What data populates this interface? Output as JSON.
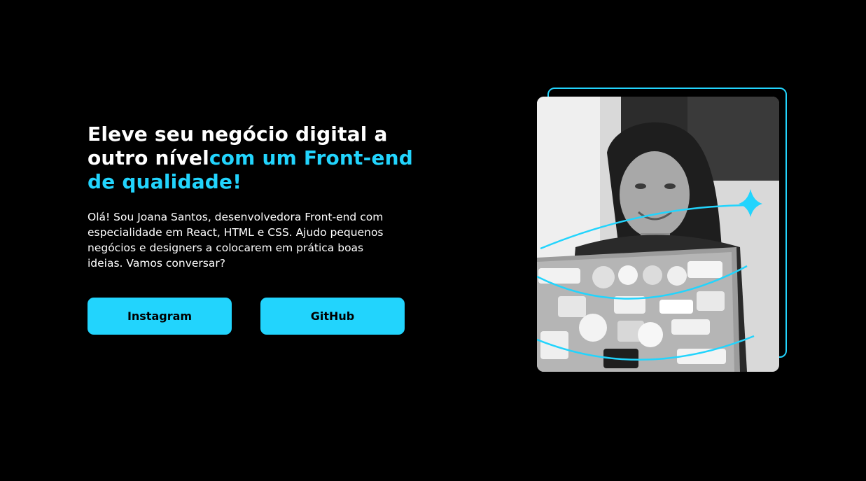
{
  "hero": {
    "headline_white": "Eleve seu negócio digital a outro nível",
    "headline_accent": "com um Front-end de qualidade!",
    "intro": "Olá! Sou Joana Santos, desenvolvedora Front-end com especialidade em React, HTML e CSS. Ajudo pequenos negócios e designers a colocarem em prática boas ideias. Vamos conversar?"
  },
  "buttons": {
    "instagram_label": "Instagram",
    "github_label": "GitHub"
  },
  "photo": {
    "alt": "Joana Santos"
  },
  "colors": {
    "background": "#000000",
    "accent": "#22d4fd",
    "text": "#ffffff"
  },
  "icons": {
    "sparkle": "sparkle-star-icon"
  }
}
